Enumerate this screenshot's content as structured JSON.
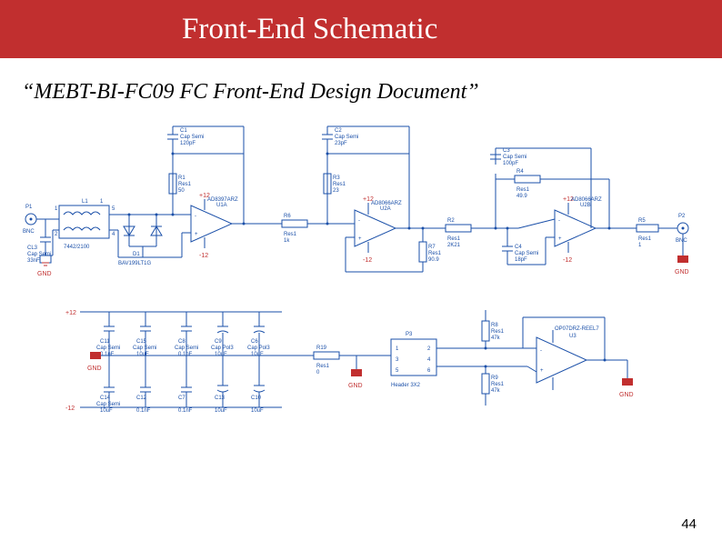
{
  "banner": {
    "title": "Front-End Schematic"
  },
  "subtitle": "“MEBT-BI-FC09 FC Front-End Design Document”",
  "pagenum": "44",
  "rails": {
    "pos": "+12",
    "neg": "-12"
  },
  "gnd_label": "GND",
  "ports": {
    "in": {
      "id": "P1",
      "label": "BNC"
    },
    "out": {
      "id": "P2",
      "label": "BNC"
    }
  },
  "parts": {
    "L1": {
      "id": "L1",
      "val": "1",
      "footprint": "7442/2100"
    },
    "D1": {
      "id": "D1",
      "val": "BAV199LT1G"
    },
    "CL3": {
      "id": "CL3",
      "type": "Cap Semi",
      "val": "33nF"
    },
    "C1": {
      "id": "C1",
      "type": "Cap Semi",
      "val": "120pF"
    },
    "R1": {
      "id": "R1",
      "type": "Res1",
      "val": "50"
    },
    "U1A": {
      "id": "U1A",
      "val": "AD8397ARZ"
    },
    "R6": {
      "id": "R6",
      "type": "Res1",
      "val": "1k"
    },
    "C2": {
      "id": "C2",
      "type": "Cap Semi",
      "val": "23pF"
    },
    "R3": {
      "id": "R3",
      "type": "Res1",
      "val": "23"
    },
    "U2A": {
      "id": "U2A",
      "val": "AD8066ARZ"
    },
    "R7": {
      "id": "R7",
      "type": "Res1",
      "val": "90.9"
    },
    "R2": {
      "id": "R2",
      "type": "Res1",
      "val": "2K21"
    },
    "C3": {
      "id": "C3",
      "type": "Cap Semi",
      "val": "100pF"
    },
    "R4": {
      "id": "R4",
      "type": "Res1",
      "val": "49.9"
    },
    "C4": {
      "id": "C4",
      "type": "Cap Semi",
      "val": "18pF"
    },
    "U2B": {
      "id": "U2B",
      "val": "AD8066ARZ"
    },
    "R5": {
      "id": "R5",
      "type": "Res1",
      "val": "1"
    },
    "C11": {
      "id": "C11",
      "type": "Cap Semi",
      "val": "0.1nF"
    },
    "C15": {
      "id": "C15",
      "type": "Cap Semi",
      "val": "10uF"
    },
    "C8": {
      "id": "C8",
      "type": "Cap Semi",
      "val": "0.1nF"
    },
    "C9": {
      "id": "C9",
      "type": "Cap Pol3",
      "val": "10uF"
    },
    "C6": {
      "id": "C6",
      "type": "Cap Pol3",
      "val": "10uF"
    },
    "C14": {
      "id": "C14",
      "type": "Cap Semi",
      "val": "10uF"
    },
    "C12": {
      "id": "C12",
      "type": "Cap Semi",
      "val": "0.1nF"
    },
    "C7": {
      "id": "C7",
      "type": "Cap Semi",
      "val": "0.1nF"
    },
    "C13": {
      "id": "C13",
      "type": "Cap Pol3",
      "val": "10uF"
    },
    "C10": {
      "id": "C10",
      "type": "Cap Pol3",
      "val": "10uF"
    },
    "R19": {
      "id": "R19",
      "type": "Res1",
      "val": "0"
    },
    "P3": {
      "id": "P3",
      "val": "Header 3X2",
      "pins": [
        "1",
        "2",
        "3",
        "4",
        "5",
        "6"
      ]
    },
    "R8": {
      "id": "R8",
      "type": "Res1",
      "val": "47k"
    },
    "R9": {
      "id": "R9",
      "type": "Res1",
      "val": "47k"
    },
    "U3": {
      "id": "U3",
      "val": "OP07DRZ-REEL7"
    }
  }
}
